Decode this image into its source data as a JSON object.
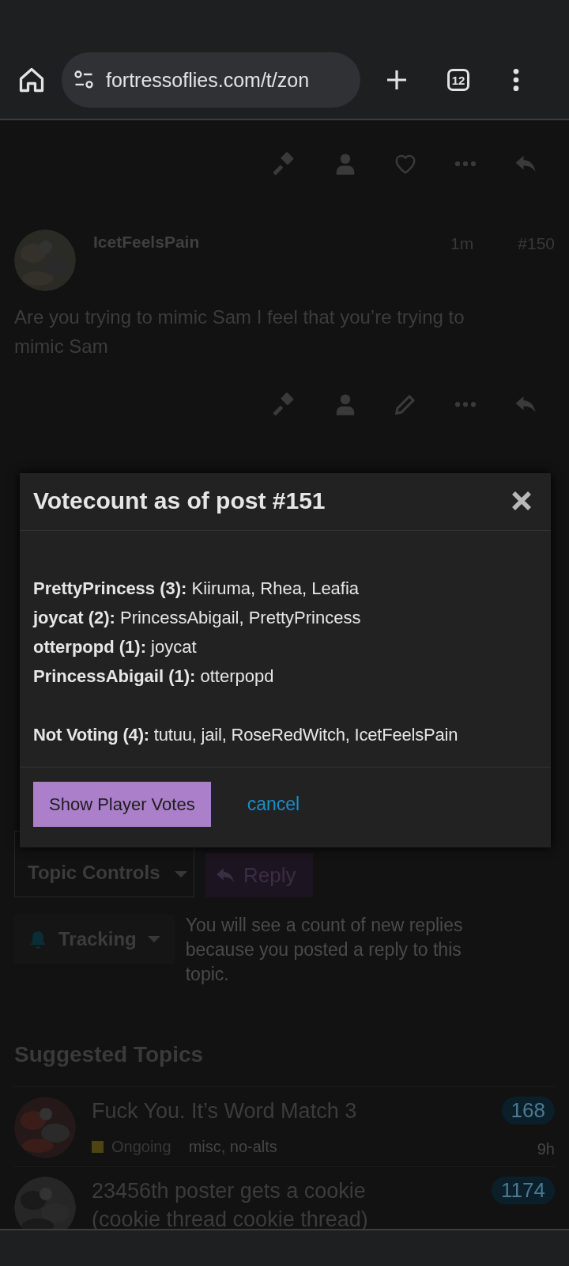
{
  "browser": {
    "url": "fortressoflies.com/t/zon",
    "tab_count": "12"
  },
  "post": {
    "author": "IcetFeelsPain",
    "age": "1m",
    "number": "#150",
    "body": "Are you trying to mimic Sam I feel that you’re trying to mimic Sam"
  },
  "modal": {
    "title": "Votecount as of post #151",
    "votes": [
      "**PrettyPrincess (3):** Kiiruma, Rhea, Leafia",
      "**joycat (2):** PrincessAbigail, PrettyPrincess",
      "**otterpopd (1):** joycat",
      "**PrincessAbigail (1):** otterpopd"
    ],
    "not_voting": "**Not Voting (4):** tutuu, jail, RoseRedWitch, IcetFeelsPain",
    "primary_button": "Show Player Votes",
    "cancel_link": "cancel"
  },
  "topic_controls": {
    "label": "Topic Controls",
    "reply": "Reply"
  },
  "tracking": {
    "label": "Tracking",
    "description": "You will see a count of new replies because you posted a reply to this topic."
  },
  "suggested": {
    "heading": "Suggested Topics",
    "topics": [
      {
        "title": "Fuck You. It’s Word Match 3",
        "count": "168",
        "category": "Ongoing",
        "color": "#4d4412",
        "tags": "misc, no-alts",
        "age": "9h"
      },
      {
        "title": "23456th poster gets a cookie (cookie thread cookie thread)",
        "count": "1174"
      }
    ]
  }
}
